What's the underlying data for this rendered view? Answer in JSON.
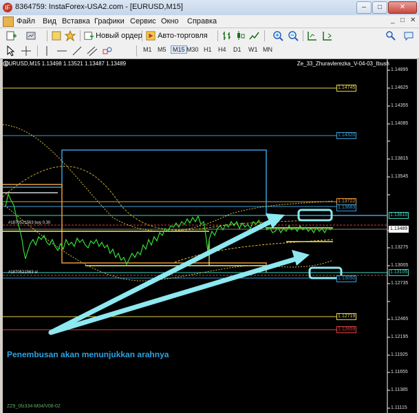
{
  "window": {
    "title": "8364759: InstaForex-USA2.com - [EURUSD,M15]",
    "icon": "instaforex-icon",
    "controls": [
      "–",
      "□",
      "✕"
    ]
  },
  "menu": {
    "items": [
      "Файл",
      "Вид",
      "Вставка",
      "Графики",
      "Сервис",
      "Окно",
      "Справка"
    ],
    "mdi_controls": [
      "_",
      "□",
      "✕"
    ]
  },
  "toolbar1": {
    "new_order_label": "Новый ордер",
    "auto_trading_label": "Авто-торговля"
  },
  "toolbar2": {
    "timeframes": [
      "M1",
      "M5",
      "M15",
      "M30",
      "H1",
      "H4",
      "D1",
      "W1",
      "MN"
    ],
    "active_timeframe": "M15"
  },
  "chart": {
    "header": "EURUSD,M15  1.13498 1.13521 1.13487 1.13489",
    "indicator_name": "Ze_33_Zhuravlerezka_V-04-03_Ibush",
    "watermark": "ZZ9_0fz334-M04/V08-02",
    "caption": "Penembusan akan menunjukkan arahnya",
    "background": "#000000",
    "axis_prices": [
      "1.14895",
      "1.14625",
      "1.14355",
      "1.14085",
      "1.13815",
      "1.13545",
      "1.13275",
      "1.13005",
      "1.12735",
      "1.12465",
      "1.12195",
      "1.11925",
      "1.11655",
      "1.11385",
      "1.11115"
    ],
    "axis_labels": [
      "1.14895",
      "1.14625",
      "1.14355",
      "1.14085",
      "1.13815",
      "1.13545",
      "1.13275",
      "1.13005",
      "1.12735",
      "1.12465",
      "1.12195",
      "1.11925",
      "1.11655",
      "1.11385",
      "1.11115"
    ],
    "level_labels": [
      {
        "text": "1.14745",
        "color": "#e8d44d"
      },
      {
        "text": "1.14320",
        "color": "#3aa0d8"
      },
      {
        "text": "1.13722",
        "color": "#e89a3a"
      },
      {
        "text": "1.13683",
        "color": "#3aa0d8"
      },
      {
        "text": "1.13610",
        "color": "#40d8c0"
      },
      {
        "text": "1.13489",
        "color": "#ffffff"
      },
      {
        "text": "1.13105",
        "color": "#40d8c0"
      },
      {
        "text": "1.13050",
        "color": "#3aa0d8"
      },
      {
        "text": "1.12719",
        "color": "#e8d44d"
      },
      {
        "text": "1.12659",
        "color": "#e04040"
      }
    ],
    "order_buy": "#1870521563 buy 0.30",
    "order_sl": "#1870521563 sl"
  },
  "axis_ticks": [
    "1.14895",
    "1.14625",
    "1.14355",
    "1.14085",
    "1.13815",
    "1.13545",
    "1.13275",
    "1.13005",
    "1.12735",
    "1.12465",
    "1.12195",
    "1.11925",
    "1.11655",
    "1.11385",
    "1.11115"
  ],
  "right_axis": [
    "1.14895",
    "1.14625",
    "1.14355",
    "1.14085",
    "1.13815",
    "1.13545",
    "1.13275",
    "1.13005",
    "1.12735",
    "1.12465",
    "1.12195",
    "1.11925",
    "1.11655",
    "1.11385",
    "1.11115"
  ]
}
